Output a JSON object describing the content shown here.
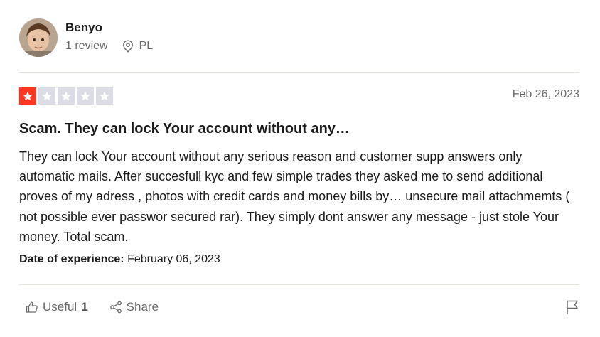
{
  "reviewer": {
    "name": "Benyo",
    "reviews": "1 review",
    "country": "PL"
  },
  "review": {
    "rating": 1,
    "max_rating": 5,
    "date": "Feb 26, 2023",
    "title": "Scam. They can lock Your account without any…",
    "body": "They can lock Your account without any serious reason and customer supp answers only automatic mails. After succesfull kyc and few simple trades they asked me to send additional proves of my adress , photos with credit cards and money bills by… unsecure mail attachmemts ( not possible ever passwor secured rar). They simply dont answer any message - just stole Your money. Total scam.",
    "experience_label": "Date of experience:",
    "experience_date": "February 06, 2023"
  },
  "actions": {
    "useful_label": "Useful",
    "useful_count": "1",
    "share_label": "Share"
  },
  "colors": {
    "star_filled": "#ff3722",
    "star_empty": "#dcdce6",
    "muted_text": "#6b6b6b"
  }
}
